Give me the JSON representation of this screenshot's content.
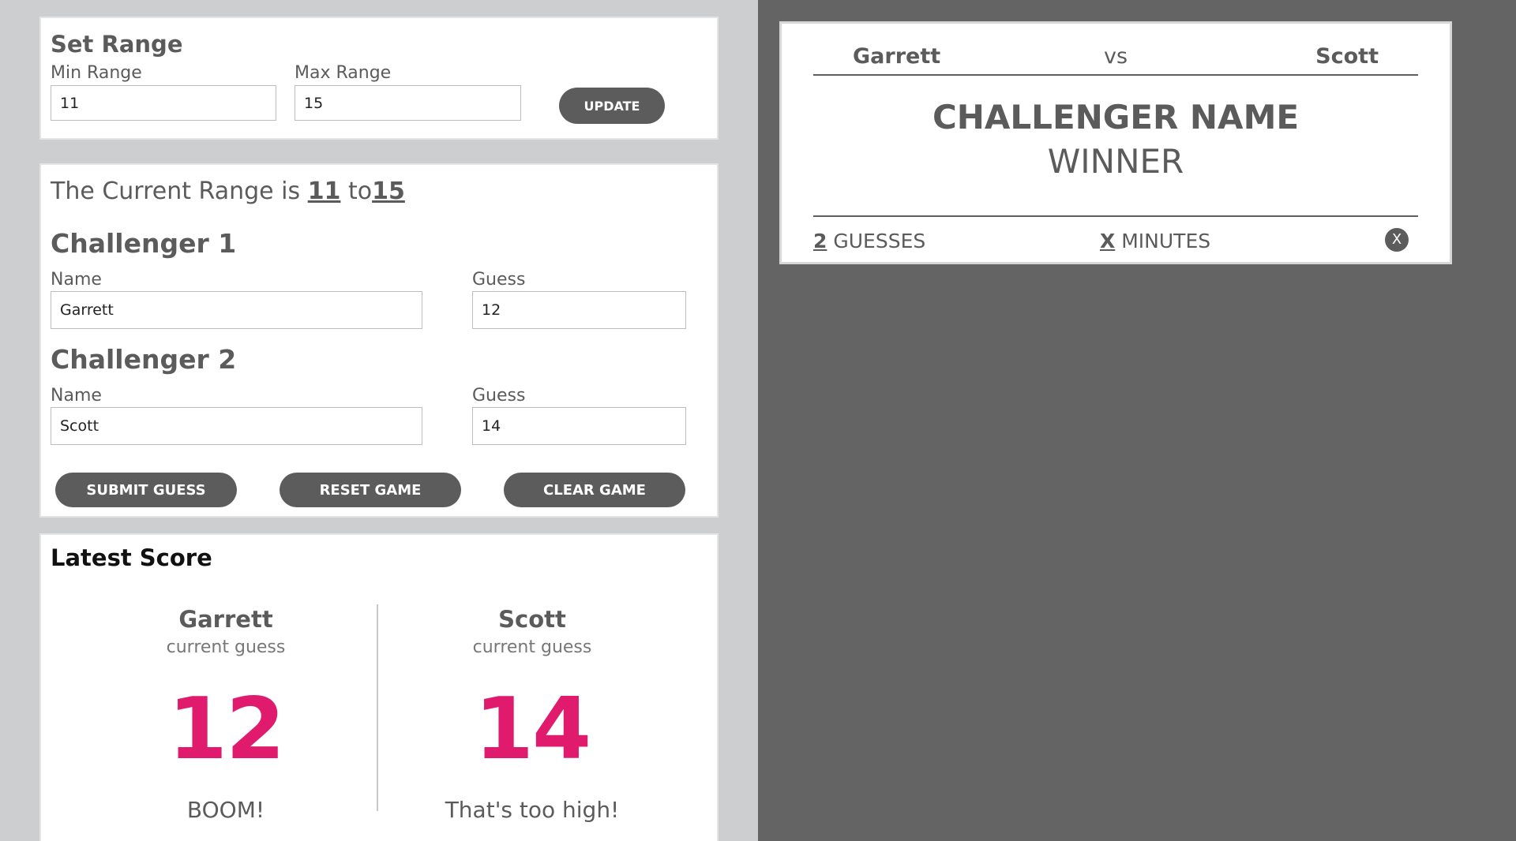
{
  "set_range": {
    "title": "Set Range",
    "min_label": "Min Range",
    "max_label": "Max Range",
    "min_value": "11",
    "max_value": "15",
    "update_button": "UPDATE"
  },
  "game": {
    "range_prefix": "The Current Range is",
    "range_min": "11",
    "range_to": "to",
    "range_max": "15",
    "challengers": [
      {
        "heading": "Challenger 1",
        "name_label": "Name",
        "name_value": "Garrett",
        "guess_label": "Guess",
        "guess_value": "12"
      },
      {
        "heading": "Challenger 2",
        "name_label": "Name",
        "name_value": "Scott",
        "guess_label": "Guess",
        "guess_value": "14"
      }
    ],
    "submit_button": "SUBMIT GUESS",
    "reset_button": "RESET GAME",
    "clear_button": "CLEAR GAME"
  },
  "latest_score": {
    "title": "Latest Score",
    "players": [
      {
        "name": "Garrett",
        "sub": "current guess",
        "guess": "12",
        "feedback": "BOOM!"
      },
      {
        "name": "Scott",
        "sub": "current guess",
        "guess": "14",
        "feedback": "That's too high!"
      }
    ]
  },
  "winner_card": {
    "player1": "Garrett",
    "vs": "vs",
    "player2": "Scott",
    "winner_name": "CHALLENGER NAME",
    "winner_label": "WINNER",
    "guesses_count": "2",
    "guesses_label": "GUESSES",
    "minutes_count": "X",
    "minutes_label": "MINUTES",
    "close_label": "X"
  },
  "colors": {
    "accent": "#e01b6e",
    "button": "#5c5c5c",
    "left_bg": "#cdced0",
    "right_bg": "#646464"
  },
  "icons": {
    "close": "close-icon"
  }
}
